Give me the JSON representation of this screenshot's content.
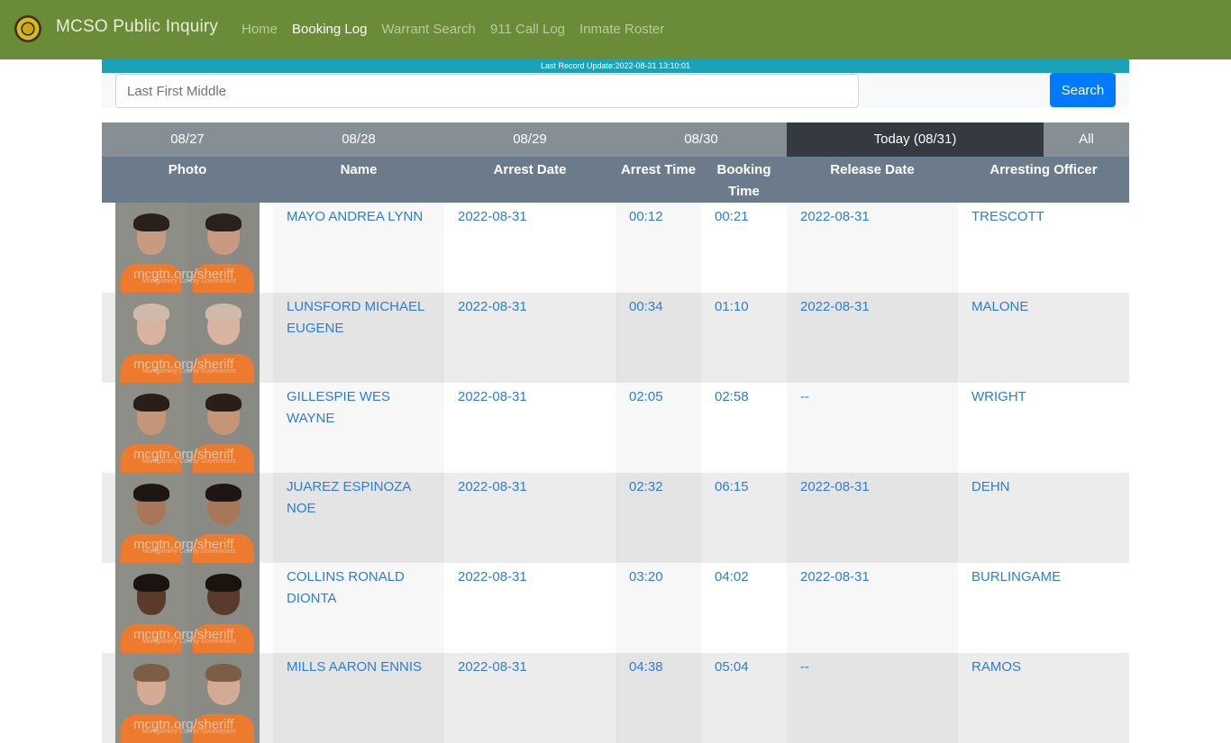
{
  "navbar": {
    "logo_icon": "sheriff-badge-icon",
    "title": "MCSO Public Inquiry",
    "links": [
      {
        "label": "Home",
        "active": false
      },
      {
        "label": "Booking Log",
        "active": true
      },
      {
        "label": "Warrant Search",
        "active": false
      },
      {
        "label": "911 Call Log",
        "active": false
      },
      {
        "label": "Inmate Roster",
        "active": false
      }
    ],
    "color": "#6a8b37"
  },
  "update_bar": {
    "text": "Last Record Update:2022-08-31 13:10:01",
    "color": "#1ca2b8"
  },
  "search": {
    "placeholder": "Last First Middle",
    "value": "",
    "button_label": "Search",
    "button_color": "#007bff"
  },
  "date_tabs": [
    {
      "label": "08/27",
      "active": false
    },
    {
      "label": "08/28",
      "active": false
    },
    {
      "label": "08/29",
      "active": false
    },
    {
      "label": "08/30",
      "active": false
    },
    {
      "label": "Today (08/31)",
      "active": true
    },
    {
      "label": "All",
      "active": false
    }
  ],
  "table": {
    "headers": [
      "Photo",
      "Name",
      "Arrest Date",
      "Arrest Time",
      "Booking Time",
      "Release Date",
      "Arresting Officer"
    ],
    "watermark": "mcgtn.org/sheriff",
    "watermark_sub": "Montgomery County Government",
    "rows": [
      {
        "name": "MAYO ANDREA LYNN",
        "arrest_date": "2022-08-31",
        "arrest_time": "00:12",
        "booking_time": "00:21",
        "release_date": "2022-08-31",
        "officer": "TRESCOTT"
      },
      {
        "name": "LUNSFORD MICHAEL EUGENE",
        "arrest_date": "2022-08-31",
        "arrest_time": "00:34",
        "booking_time": "01:10",
        "release_date": "2022-08-31",
        "officer": "MALONE"
      },
      {
        "name": "GILLESPIE WES WAYNE",
        "arrest_date": "2022-08-31",
        "arrest_time": "02:05",
        "booking_time": "02:58",
        "release_date": "--",
        "officer": "WRIGHT"
      },
      {
        "name": "JUAREZ ESPINOZA NOE",
        "arrest_date": "2022-08-31",
        "arrest_time": "02:32",
        "booking_time": "06:15",
        "release_date": "2022-08-31",
        "officer": "DEHN"
      },
      {
        "name": "COLLINS RONALD DIONTA",
        "arrest_date": "2022-08-31",
        "arrest_time": "03:20",
        "booking_time": "04:02",
        "release_date": "2022-08-31",
        "officer": "BURLINGAME"
      },
      {
        "name": "MILLS AARON ENNIS",
        "arrest_date": "2022-08-31",
        "arrest_time": "04:38",
        "booking_time": "05:04",
        "release_date": "--",
        "officer": "RAMOS"
      }
    ]
  }
}
